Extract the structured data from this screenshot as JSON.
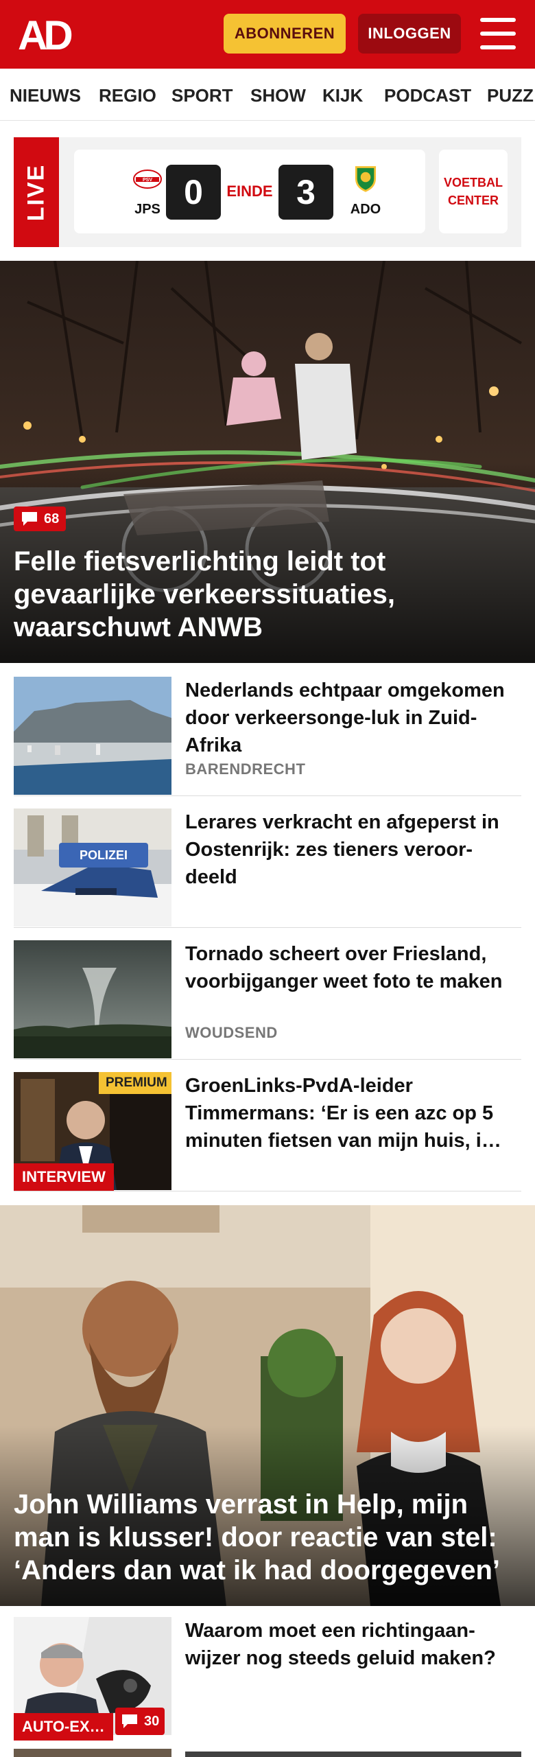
{
  "header": {
    "logo_text": "AD",
    "subscribe_label": "ABONNEREN",
    "login_label": "INLOGGEN"
  },
  "nav": {
    "items": [
      "NIEUWS",
      "REGIO",
      "SPORT",
      "SHOW",
      "KIJK",
      "PODCAST",
      "PUZZ"
    ]
  },
  "live": {
    "tab_label": "LIVE",
    "home_team": "JPS",
    "home_score": "0",
    "status": "EINDE",
    "away_score": "3",
    "away_team": "ADO",
    "center_label_1": "VOETBAL",
    "center_label_2": "CENTER"
  },
  "hero1": {
    "comments": "68",
    "title": "Felle fietsverlichting leidt tot gevaarlijke verkeerssituaties, waarschuwt ANWB"
  },
  "articles": [
    {
      "title": "Nederlands echtpaar omgekomen door verkeersonge-luk in Zuid-Afrika",
      "kicker": "BARENDRECHT"
    },
    {
      "title": "Lerares verkracht en afgeperst in Oostenrijk: zes tieners veroor-deeld",
      "kicker": ""
    },
    {
      "title": "Tornado scheert over Friesland, voorbijganger weet foto te maken",
      "kicker": "WOUDSEND"
    },
    {
      "title": "GroenLinks-PvdA-leider Timmermans: ‘Er is een azc op 5 minuten fietsen van mijn huis, i…",
      "kicker": "",
      "label": "INTERVIEW",
      "premium": "PREMIUM"
    }
  ],
  "thumbs": {
    "police_sign": "POLIZEI"
  },
  "hero2": {
    "title": "John Williams verrast in Help, mijn man is klusser! door reactie van stel: ‘Anders dan wat ik had doorgegeven’"
  },
  "article5": {
    "title": "Waarom moet een richtingaan-wijzer nog steeds geluid maken?",
    "label": "AUTO-EX…",
    "comments": "30"
  },
  "colors": {
    "brand_red": "#d10a11",
    "premium_yellow": "#f5c233",
    "dark_red": "#9c0a10"
  }
}
